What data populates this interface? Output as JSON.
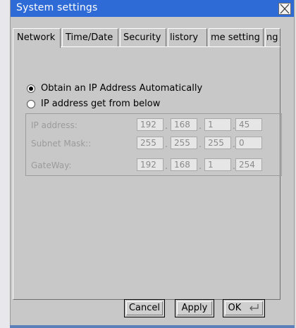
{
  "window": {
    "title": "System settings"
  },
  "tabs": [
    {
      "label": "Network",
      "active": true
    },
    {
      "label": "Time/Date"
    },
    {
      "label": "Security"
    },
    {
      "label": "listory"
    },
    {
      "label": "me setting"
    },
    {
      "label": "ng"
    }
  ],
  "network": {
    "options": [
      {
        "label": "Obtain an IP Address Automatically",
        "selected": true
      },
      {
        "label": "IP address get from below",
        "selected": false
      }
    ],
    "fields": [
      {
        "label": "IP address:",
        "octets": [
          "192",
          "168",
          "1",
          "45"
        ]
      },
      {
        "label": "Subnet Mask::",
        "octets": [
          "255",
          "255",
          "255",
          "0"
        ]
      },
      {
        "label": "GateWay:",
        "octets": [
          "192",
          "168",
          "1",
          "254"
        ]
      }
    ],
    "separator": "."
  },
  "buttons": {
    "cancel": "Cancel",
    "apply": "Apply",
    "ok": "OK"
  },
  "colors": {
    "titlebar": "#2e6bd6",
    "dialog": "#c8c8c8"
  },
  "icons": {
    "close": "close-x-icon",
    "ok": "enter-key-icon"
  }
}
